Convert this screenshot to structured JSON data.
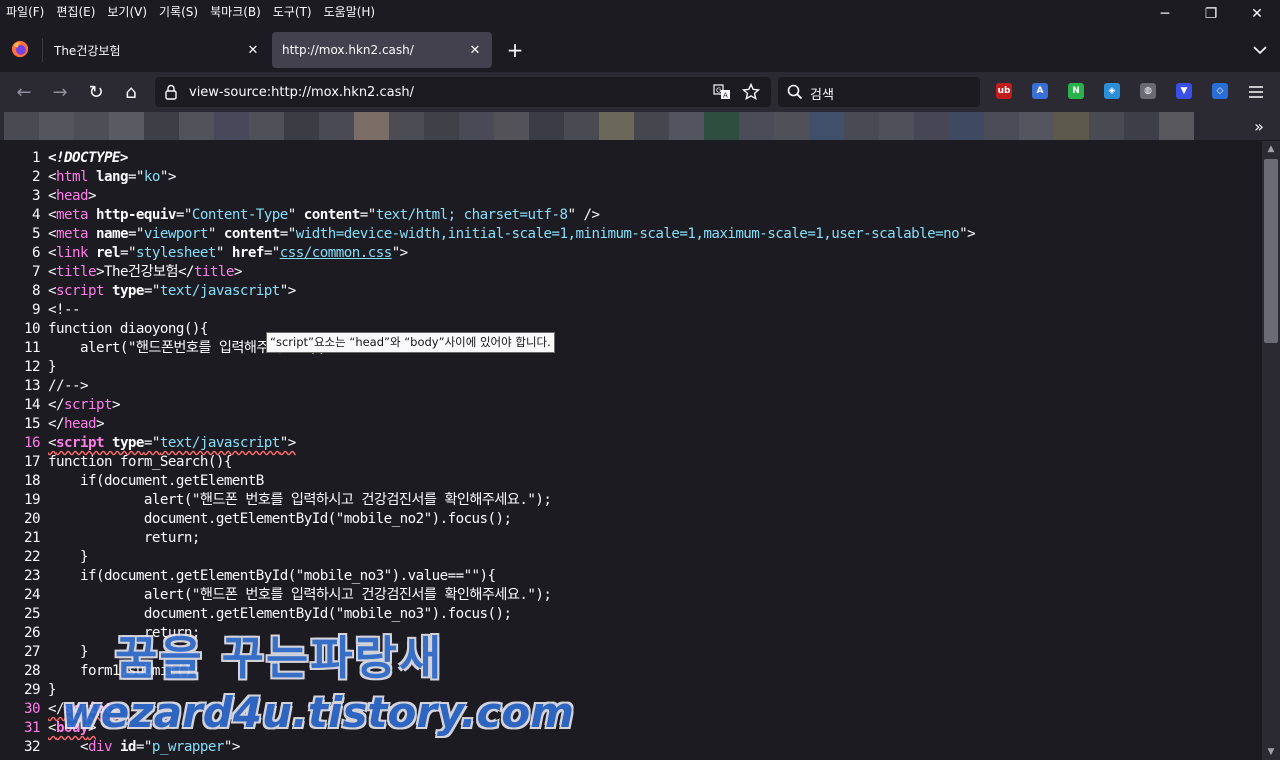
{
  "menubar": {
    "items": [
      "파일(F)",
      "편집(E)",
      "보기(V)",
      "기록(S)",
      "북마크(B)",
      "도구(T)",
      "도움말(H)"
    ]
  },
  "window_controls": {
    "minimize": "─",
    "restore": "❐",
    "close": "✕"
  },
  "tabs": [
    {
      "label": "The건강보험",
      "close": "✕"
    },
    {
      "label": "http://mox.hkn2.cash/",
      "close": "✕"
    }
  ],
  "toolbar": {
    "new_tab": "+",
    "tab_list": "⌄",
    "back": "←",
    "forward": "→",
    "reload": "↻",
    "home": "⌂"
  },
  "urlbar": {
    "url": "view-source:http://mox.hkn2.cash/"
  },
  "searchbar": {
    "placeholder": "검색"
  },
  "extensions": [
    {
      "name": "ublock-icon",
      "label": "ub",
      "color": "#c21c1c"
    },
    {
      "name": "translate-icon",
      "label": "A",
      "color": "#3a6fd8"
    },
    {
      "name": "n-extension-icon",
      "label": "N",
      "color": "#2ab24a"
    },
    {
      "name": "shield-extension-icon",
      "label": "◈",
      "color": "#2a8fd8"
    },
    {
      "name": "globe-extension-icon",
      "label": "◍",
      "color": "#6a6a72"
    },
    {
      "name": "vpn-extension-icon",
      "label": "▼",
      "color": "#3a4fe8"
    },
    {
      "name": "guard-extension-icon",
      "label": "◇",
      "color": "#2a6fd8"
    }
  ],
  "bookmarks_overflow": "»",
  "source_lines": [
    {
      "n": "1",
      "segs": [
        [
          "doctype",
          "<!DOCTYPE>"
        ]
      ]
    },
    {
      "n": "2",
      "segs": [
        [
          "p",
          "<"
        ],
        [
          "tag",
          "html "
        ],
        [
          "attr",
          "lang"
        ],
        [
          "p",
          "=\""
        ],
        [
          "val",
          "ko"
        ],
        [
          "p",
          "\">"
        ]
      ]
    },
    {
      "n": "3",
      "segs": [
        [
          "p",
          "<"
        ],
        [
          "tag",
          "head"
        ],
        [
          "p",
          ">"
        ]
      ]
    },
    {
      "n": "4",
      "segs": [
        [
          "p",
          "<"
        ],
        [
          "tag",
          "meta "
        ],
        [
          "attr",
          "http-equiv"
        ],
        [
          "p",
          "=\""
        ],
        [
          "val",
          "Content-Type"
        ],
        [
          "p",
          "\" "
        ],
        [
          "attr",
          "content"
        ],
        [
          "p",
          "=\""
        ],
        [
          "val",
          "text/html; charset=utf-8"
        ],
        [
          "p",
          "\" />"
        ]
      ]
    },
    {
      "n": "5",
      "segs": [
        [
          "p",
          "<"
        ],
        [
          "tag",
          "meta "
        ],
        [
          "attr",
          "name"
        ],
        [
          "p",
          "=\""
        ],
        [
          "val",
          "viewport"
        ],
        [
          "p",
          "\" "
        ],
        [
          "attr",
          "content"
        ],
        [
          "p",
          "=\""
        ],
        [
          "val",
          "width=device-width,initial-scale=1,minimum-scale=1,maximum-scale=1,user-scalable=no"
        ],
        [
          "p",
          "\">"
        ]
      ]
    },
    {
      "n": "6",
      "segs": [
        [
          "p",
          "<"
        ],
        [
          "tag",
          "link "
        ],
        [
          "attr",
          "rel"
        ],
        [
          "p",
          "=\""
        ],
        [
          "val",
          "stylesheet"
        ],
        [
          "p",
          "\" "
        ],
        [
          "attr",
          "href"
        ],
        [
          "p",
          "=\""
        ],
        [
          "link",
          "css/common.css"
        ],
        [
          "p",
          "\">"
        ]
      ]
    },
    {
      "n": "7",
      "segs": [
        [
          "p",
          "<"
        ],
        [
          "tag",
          "title"
        ],
        [
          "p",
          ">The건강보험</"
        ],
        [
          "tag",
          "title"
        ],
        [
          "p",
          ">"
        ]
      ]
    },
    {
      "n": "8",
      "segs": [
        [
          "p",
          "<"
        ],
        [
          "tag",
          "script "
        ],
        [
          "attr",
          "type"
        ],
        [
          "p",
          "=\""
        ],
        [
          "val",
          "text/javascript"
        ],
        [
          "p",
          "\">"
        ]
      ]
    },
    {
      "n": "9",
      "segs": [
        [
          "p",
          "<!--"
        ]
      ]
    },
    {
      "n": "10",
      "segs": [
        [
          "p",
          "function diaoyong(){"
        ]
      ]
    },
    {
      "n": "11",
      "segs": [
        [
          "p",
          "    alert(\"핸드폰번호를 입력해주세요.\");"
        ]
      ]
    },
    {
      "n": "12",
      "segs": [
        [
          "p",
          "}"
        ]
      ]
    },
    {
      "n": "13",
      "segs": [
        [
          "p",
          "//-->"
        ]
      ]
    },
    {
      "n": "14",
      "segs": [
        [
          "p",
          "</"
        ],
        [
          "tag",
          "script"
        ],
        [
          "p",
          ">"
        ]
      ]
    },
    {
      "n": "15",
      "segs": [
        [
          "p",
          "</"
        ],
        [
          "tag",
          "head"
        ],
        [
          "p",
          ">"
        ]
      ]
    },
    {
      "n": "16",
      "err": true,
      "segs": [
        [
          "p",
          "<"
        ],
        [
          "tag",
          "script "
        ],
        [
          "attr",
          "type"
        ],
        [
          "p",
          "=\""
        ],
        [
          "val",
          "text/javascript"
        ],
        [
          "p",
          "\">"
        ]
      ]
    },
    {
      "n": "17",
      "segs": [
        [
          "p",
          "function form_Search(){"
        ]
      ]
    },
    {
      "n": "18",
      "segs": [
        [
          "p",
          "    if(document.getElementB"
        ]
      ]
    },
    {
      "n": "19",
      "segs": [
        [
          "p",
          "            alert(\"핸드폰 번호를 입력하시고 건강검진서를 확인해주세요.\");"
        ]
      ]
    },
    {
      "n": "20",
      "segs": [
        [
          "p",
          "            document.getElementById(\"mobile_no2\").focus();"
        ]
      ]
    },
    {
      "n": "21",
      "segs": [
        [
          "p",
          "            return;"
        ]
      ]
    },
    {
      "n": "22",
      "segs": [
        [
          "p",
          "    }"
        ]
      ]
    },
    {
      "n": "23",
      "segs": [
        [
          "p",
          "    if(document.getElementById(\"mobile_no3\").value==\"\"){"
        ]
      ]
    },
    {
      "n": "24",
      "segs": [
        [
          "p",
          "            alert(\"핸드폰 번호를 입력하시고 건강검진서를 확인해주세요.\");"
        ]
      ]
    },
    {
      "n": "25",
      "segs": [
        [
          "p",
          "            document.getElementById(\"mobile_no3\").focus();"
        ]
      ]
    },
    {
      "n": "26",
      "segs": [
        [
          "p",
          "            return;"
        ]
      ]
    },
    {
      "n": "27",
      "segs": [
        [
          "p",
          "    }"
        ]
      ]
    },
    {
      "n": "28",
      "segs": [
        [
          "p",
          "    form1.submit();"
        ]
      ]
    },
    {
      "n": "29",
      "segs": [
        [
          "p",
          "}"
        ]
      ]
    },
    {
      "n": "30",
      "err": true,
      "segs": [
        [
          "p",
          "</"
        ],
        [
          "tag",
          "script"
        ],
        [
          "p",
          ">"
        ]
      ]
    },
    {
      "n": "31",
      "err": true,
      "segs": [
        [
          "p",
          "<"
        ],
        [
          "tag",
          "body"
        ],
        [
          "p",
          ">"
        ]
      ]
    },
    {
      "n": "32",
      "segs": [
        [
          "p",
          "    <"
        ],
        [
          "tag",
          "div "
        ],
        [
          "attr",
          "id"
        ],
        [
          "p",
          "=\""
        ],
        [
          "val",
          "p_wrapper"
        ],
        [
          "p",
          "\">"
        ]
      ]
    }
  ],
  "tooltip": {
    "text": "“script”요소는 “head”와 “body”사이에 있어야 합니다."
  },
  "watermark": {
    "line1": "꿈을 꾸는파랑새",
    "line2": "wezard4u.tistory.com"
  }
}
